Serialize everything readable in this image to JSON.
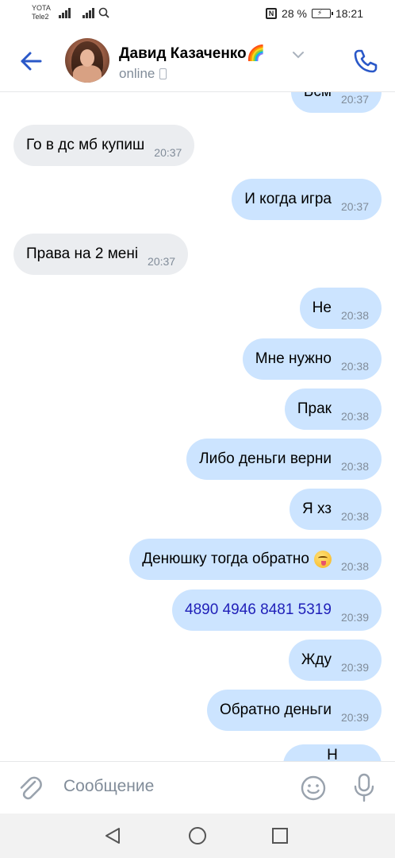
{
  "status_bar": {
    "carrier_1": "YOTA",
    "carrier_2": "Tele2",
    "battery_percent": "28 %",
    "time": "18:21"
  },
  "header": {
    "contact_name": "Давид Казаченко🌈",
    "status": "online"
  },
  "messages": [
    {
      "dir": "out",
      "text": "Бсм",
      "time": "20:37",
      "partial": true
    },
    {
      "dir": "in",
      "text": "Го в дс мб купиш",
      "time": "20:37"
    },
    {
      "dir": "out",
      "text": "И когда игра",
      "time": "20:37"
    },
    {
      "dir": "in",
      "text": "Права на 2 мені",
      "time": "20:37"
    },
    {
      "dir": "out",
      "text": "Не",
      "time": "20:38"
    },
    {
      "dir": "out",
      "text": "Мне нужно",
      "time": "20:38"
    },
    {
      "dir": "out",
      "text": "Прак",
      "time": "20:38"
    },
    {
      "dir": "out",
      "text": "Либо деньги верни",
      "time": "20:38"
    },
    {
      "dir": "out",
      "text": "Я хз",
      "time": "20:38"
    },
    {
      "dir": "out",
      "text": "Денюшку тогда обратно",
      "time": "20:38",
      "emoji": "yum-emoji"
    },
    {
      "dir": "out",
      "text": "4890 4946 8481 5319",
      "time": "20:39",
      "link": true
    },
    {
      "dir": "out",
      "text": "Жду",
      "time": "20:39"
    },
    {
      "dir": "out",
      "text": "Обратно деньги",
      "time": "20:39"
    },
    {
      "dir": "out",
      "text": "Н",
      "time": "",
      "partial": true
    }
  ],
  "composer": {
    "placeholder": "Сообщение"
  },
  "colors": {
    "accent": "#2a58c8",
    "incoming_bubble": "#ebedf0",
    "outgoing_bubble": "#cce4ff",
    "secondary_text": "#818c99",
    "link_text": "#1f1fb8"
  },
  "icons": {
    "back": "arrow-left-icon",
    "call": "phone-icon",
    "attach": "paperclip-icon",
    "emoji": "smiley-icon",
    "mic": "microphone-icon"
  }
}
